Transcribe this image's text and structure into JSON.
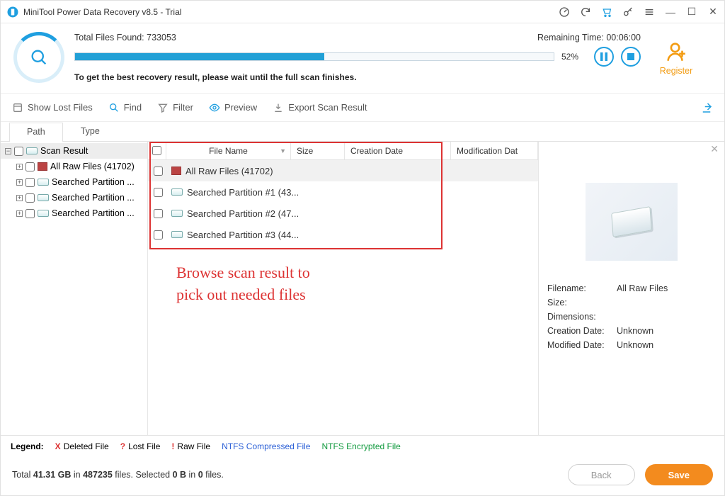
{
  "title": "MiniTool Power Data Recovery v8.5 - Trial",
  "scan": {
    "total_label": "Total Files Found:",
    "total_value": "733053",
    "remaining_label": "Remaining Time:",
    "remaining_value": "00:06:00",
    "percent": "52%",
    "note": "To get the best recovery result, please wait until the full scan finishes."
  },
  "register_label": "Register",
  "toolbar": {
    "show_lost": "Show Lost Files",
    "find": "Find",
    "filter": "Filter",
    "preview": "Preview",
    "export": "Export Scan Result"
  },
  "tabs": {
    "path": "Path",
    "type": "Type"
  },
  "tree": {
    "root": "Scan Result",
    "items": [
      "All Raw Files (41702)",
      "Searched Partition ...",
      "Searched Partition ...",
      "Searched Partition ..."
    ]
  },
  "columns": {
    "name": "File Name",
    "size": "Size",
    "cdate": "Creation Date",
    "mdate": "Modification Dat"
  },
  "rows": [
    "All Raw Files (41702)",
    "Searched Partition #1 (43...",
    "Searched Partition #2 (47...",
    "Searched Partition #3 (44..."
  ],
  "annotation": "Browse scan result to\npick out needed files",
  "preview": {
    "labels": {
      "fn": "Filename:",
      "sz": "Size:",
      "dim": "Dimensions:",
      "cd": "Creation Date:",
      "md": "Modified Date:"
    },
    "filename": "All Raw Files",
    "size": "",
    "dimensions": "",
    "cdate": "Unknown",
    "mdate": "Unknown"
  },
  "legend": {
    "title": "Legend:",
    "deleted": "Deleted File",
    "lost": "Lost File",
    "raw": "Raw File",
    "ntfs_c": "NTFS Compressed File",
    "ntfs_e": "NTFS Encrypted File"
  },
  "footer": {
    "total_prefix": "Total ",
    "total_size": "41.31 GB",
    "in": " in ",
    "total_files": "487235",
    "files_sel": " files.  Selected ",
    "sel_size": "0 B",
    "sel_in": " in ",
    "sel_count": "0",
    "sel_suffix": " files.",
    "back": "Back",
    "save": "Save"
  }
}
